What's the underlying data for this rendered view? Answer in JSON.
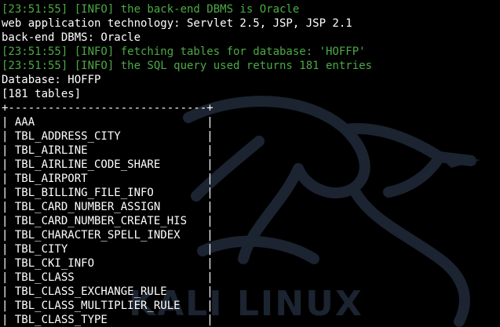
{
  "theme": {
    "background": "#000000",
    "text_color": "#ffffff",
    "info_color": "#4caa45",
    "watermark_color": "#1b2430"
  },
  "watermark": {
    "text": "KALI LINUX",
    "icon": "kali-dragon-icon"
  },
  "lines": {
    "l1": "[23:51:55] [INFO] the back-end DBMS is Oracle",
    "l2": "web application technology: Servlet 2.5, JSP, JSP 2.1",
    "l3": "back-end DBMS: Oracle",
    "l4": "[23:51:55] [INFO] fetching tables for database: 'HOFFP'",
    "l5": "[23:51:55] [INFO] the SQL query used returns 181 entries",
    "l6": "Database: HOFFP",
    "l7": "[181 tables]"
  },
  "table": {
    "border": "+------------------------------+",
    "rows": [
      "| AAA                          |",
      "| TBL_ADDRESS_CITY             |",
      "| TBL_AIRLINE                  |",
      "| TBL_AIRLINE_CODE_SHARE       |",
      "| TBL_AIRPORT                  |",
      "| TBL_BILLING_FILE_INFO        |",
      "| TBL_CARD_NUMBER_ASSIGN       |",
      "| TBL_CARD_NUMBER_CREATE_HIS   |",
      "| TBL_CHARACTER_SPELL_INDEX    |",
      "| TBL_CITY                     |",
      "| TBL_CKI_INFO                 |",
      "| TBL_CLASS                    |",
      "| TBL_CLASS_EXCHANGE_RULE      |",
      "| TBL_CLASS_MULTIPLIER_RULE    |",
      "| TBL_CLASS_TYPE               |"
    ]
  }
}
